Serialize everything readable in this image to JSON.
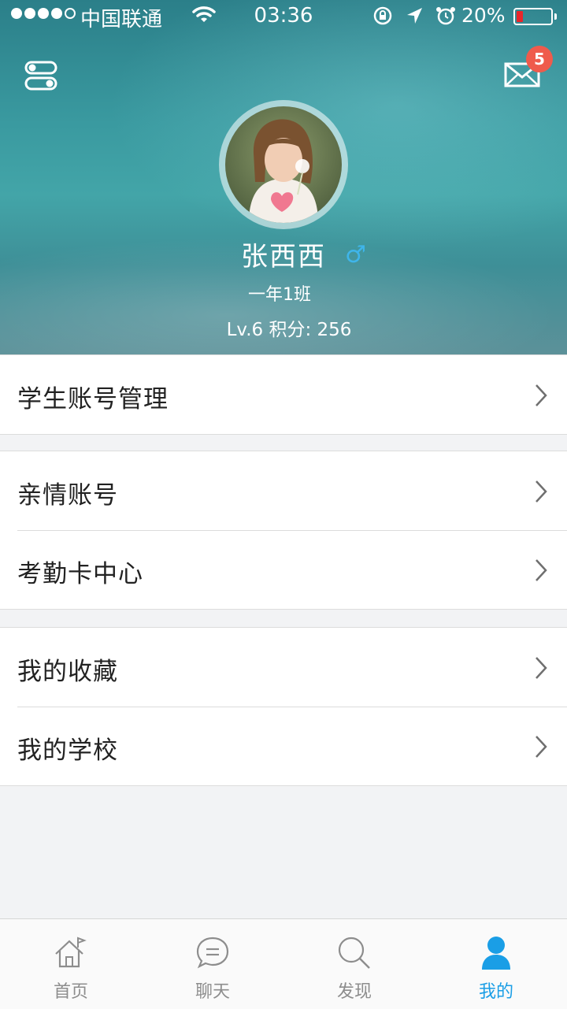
{
  "status_bar": {
    "carrier": "中国联通",
    "time": "03:36",
    "battery_percent": "20%",
    "battery_level": 0.2
  },
  "header": {
    "mail_badge_count": "5",
    "user": {
      "name": "张西西",
      "gender_symbol": "♂",
      "class_name": "一年1班",
      "level_points": "Lv.6  积分: 256"
    }
  },
  "menu": {
    "group1": [
      {
        "label": "学生账号管理"
      }
    ],
    "group2": [
      {
        "label": "亲情账号"
      },
      {
        "label": "考勤卡中心"
      }
    ],
    "group3": [
      {
        "label": "我的收藏"
      },
      {
        "label": "我的学校"
      }
    ]
  },
  "tabbar": {
    "tabs": [
      {
        "label": "首页",
        "icon": "home-icon"
      },
      {
        "label": "聊天",
        "icon": "chat-icon"
      },
      {
        "label": "发现",
        "icon": "search-icon"
      },
      {
        "label": "我的",
        "icon": "person-icon",
        "active": true
      }
    ]
  },
  "colors": {
    "accent": "#1a9ee6",
    "badge": "#ef5b4c",
    "gender": "#3fb5ea",
    "header_teal": "#3a9aa0"
  }
}
